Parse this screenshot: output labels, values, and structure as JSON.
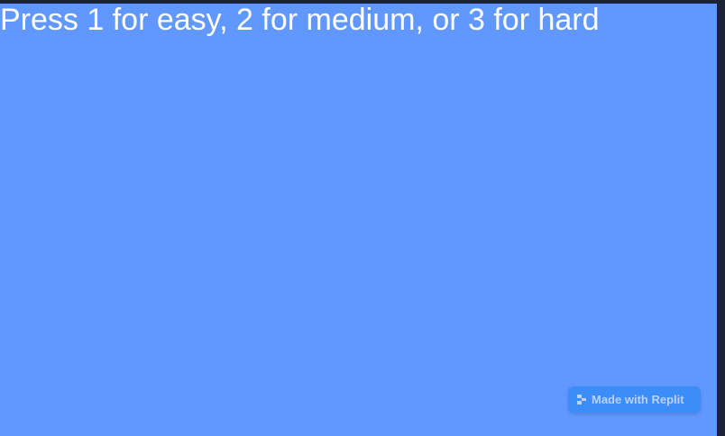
{
  "game": {
    "prompt": "Press 1 for easy, 2 for medium, or 3 for hard",
    "background_color": "#6198ff"
  },
  "badge": {
    "label": "Made with Replit",
    "icon": "replit-logo-icon"
  }
}
